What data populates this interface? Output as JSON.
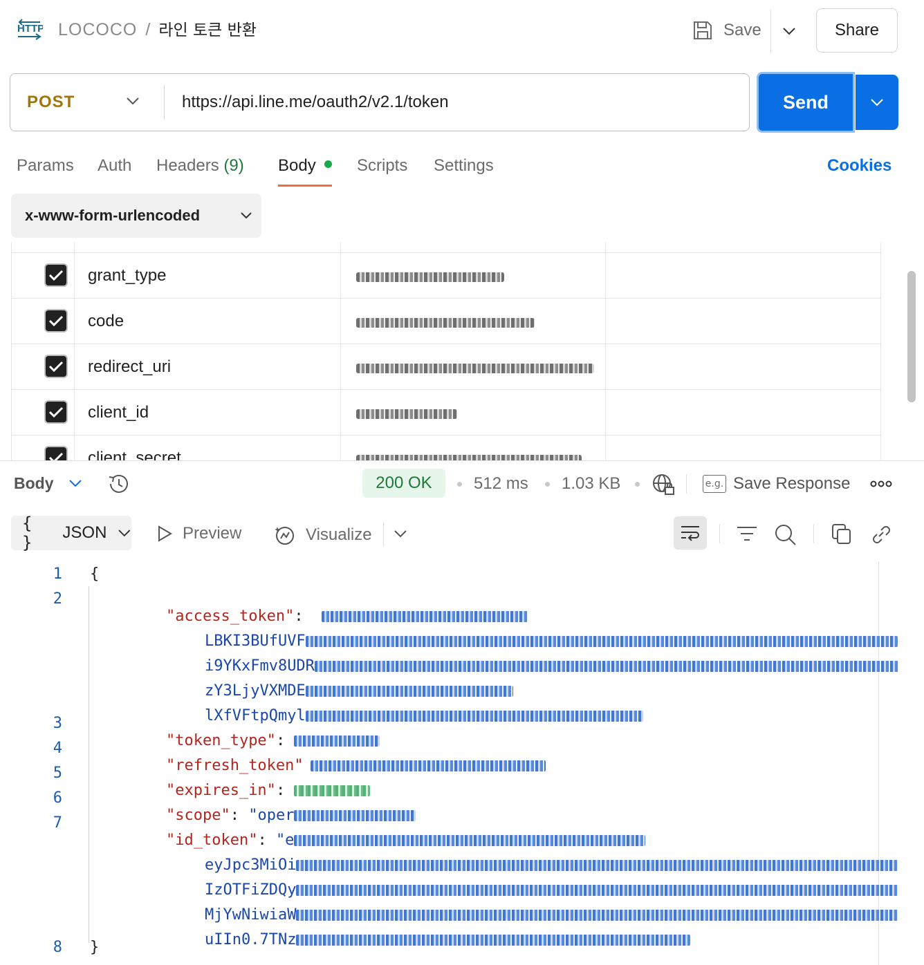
{
  "header": {
    "http_badge": "HTTP",
    "workspace": "LOCOCO",
    "separator": "/",
    "request_name": "라인 토큰 반환",
    "save_label": "Save",
    "share_label": "Share"
  },
  "request": {
    "method": "POST",
    "url": "https://api.line.me/oauth2/v2.1/token",
    "send_label": "Send"
  },
  "tabs": {
    "params": "Params",
    "auth": "Auth",
    "headers": "Headers",
    "headers_count": "(9)",
    "body": "Body",
    "scripts": "Scripts",
    "settings": "Settings",
    "active": "Body",
    "cookies": "Cookies"
  },
  "body_type": "x-www-form-urlencoded",
  "params": [
    {
      "key": "grant_type",
      "checked": true
    },
    {
      "key": "code",
      "checked": true
    },
    {
      "key": "redirect_uri",
      "checked": true
    },
    {
      "key": "client_id",
      "checked": true
    },
    {
      "key": "client_secret",
      "checked": true
    }
  ],
  "response": {
    "body_label": "Body",
    "status": "200 OK",
    "time": "512 ms",
    "size": "1.03 KB",
    "eg_label": "e.g.",
    "save_response": "Save Response",
    "format": "JSON",
    "format_braces": "{ }",
    "preview": "Preview",
    "visualize": "Visualize"
  },
  "code": {
    "line_numbers": [
      "1",
      "2",
      "3",
      "4",
      "5",
      "6",
      "7",
      "8"
    ],
    "open_brace": "{",
    "close_brace": "}",
    "access_token_key": "\"access_token\"",
    "access_token_fragments": [
      "LBKI3BUfUVF",
      "i9YKxFmv8UDR",
      "zY3LjyVXMDE",
      "lXfVFtpQmyl"
    ],
    "token_type_key": "\"token_type\"",
    "refresh_token_key": "\"refresh_token\"",
    "expires_in_key": "\"expires_in\"",
    "scope_key": "\"scope\"",
    "scope_value_prefix": "\"oper",
    "id_token_key": "\"id_token\"",
    "id_token_value_prefix": "\"e",
    "id_token_fragments": [
      "eyJpc3MiOi",
      "IzOTFiZDQy",
      "MjYwNiwiaW",
      "uIIn0.7TNz"
    ]
  },
  "colors": {
    "accent": "#0a6fe5",
    "method": "#a0760b",
    "status_ok": "#1d7a36",
    "json_key": "#b3261e",
    "json_string": "#1a47a8",
    "tab_underline": "#f26b3a"
  }
}
